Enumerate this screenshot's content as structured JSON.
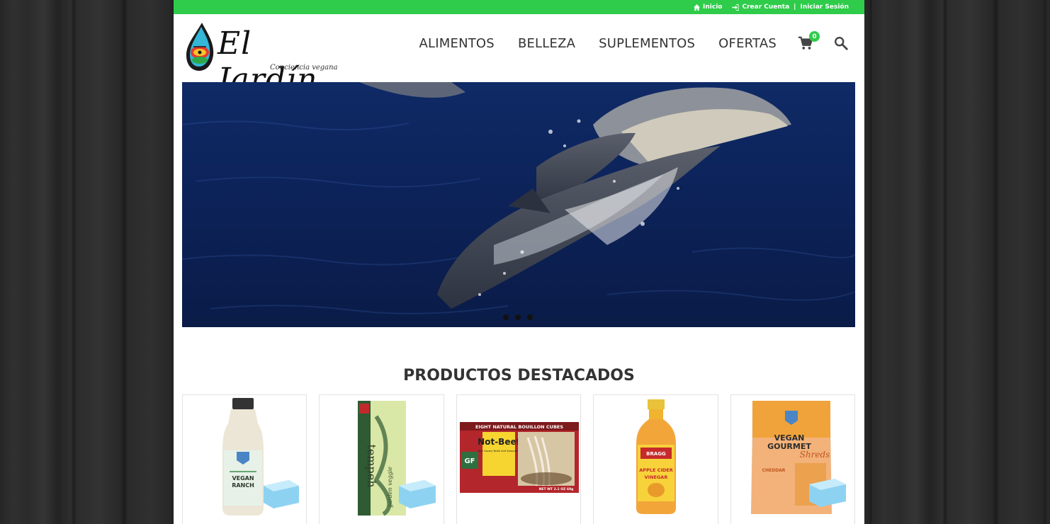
{
  "topbar": {
    "home_label": "Inicio",
    "create_account_label": "Crear Cuenta",
    "separator": "|",
    "login_label": "Iniciar Sesión"
  },
  "brand": {
    "name": "El Jardín",
    "tagline": "Conciencia vegana"
  },
  "nav": {
    "items": [
      "ALIMENTOS",
      "BELLEZA",
      "SUPLEMENTOS",
      "OFERTAS"
    ],
    "cart_count": "0",
    "cart_icon": "cart-icon",
    "search_icon": "search-icon"
  },
  "slider": {
    "dot_count": 3,
    "active_dot": 1
  },
  "featured": {
    "title": "PRODUCTOS DESTACADOS",
    "products": [
      {
        "label_line1": "VEGAN",
        "label_line2": "RANCH"
      },
      {
        "label_line1": "tempeh",
        "label_line2": "garden veggie"
      },
      {
        "label_line1": "EIGHT NATURAL BOUILLON CUBES",
        "label_line2": "Not-Beef",
        "label_line3": "Rich Savory Broth And Seasoning",
        "label_line4": "GF",
        "label_line5": "NET WT 2.1 OZ 60g"
      },
      {
        "label_line1": "BRAGG",
        "label_line2": "APPLE CIDER",
        "label_line3": "VINEGAR"
      },
      {
        "label_line1": "VEGAN",
        "label_line2": "GOURMET",
        "label_line3": "Shreds",
        "label_line4": "CHEDDAR"
      }
    ]
  },
  "colors": {
    "accent": "#2ecc4a",
    "text": "#333333"
  }
}
